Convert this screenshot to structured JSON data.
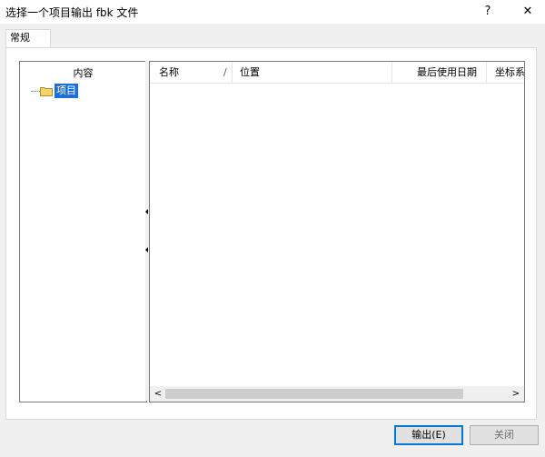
{
  "window": {
    "title": "选择一个项目输出 fbk 文件",
    "help_label": "?",
    "close_label": "✕"
  },
  "tabs": [
    {
      "label": "常规",
      "active": true
    }
  ],
  "tree": {
    "header": "内容",
    "items": [
      {
        "label": "项目",
        "icon": "folder-icon",
        "selected": true
      }
    ]
  },
  "list": {
    "columns": [
      {
        "label": "名称",
        "sort": "/"
      },
      {
        "label": "位置"
      },
      {
        "label": "最后使用日期"
      },
      {
        "label": "坐标系"
      }
    ],
    "rows": []
  },
  "scrollbar": {
    "left_label": "<",
    "right_label": ">"
  },
  "buttons": {
    "export_label": "输出(E)",
    "close_label": "关闭"
  },
  "colors": {
    "selection": "#1e6fd2",
    "default_button_border": "#0078d7",
    "folder": "#f5d66b"
  }
}
